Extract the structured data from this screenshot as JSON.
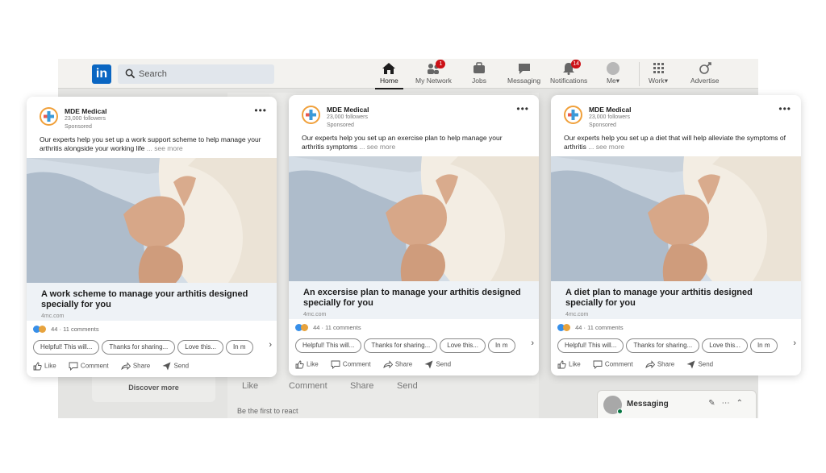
{
  "background": {
    "nav": {
      "logo": "in",
      "search_placeholder": "Search",
      "items": [
        {
          "label": "Home",
          "badge": ""
        },
        {
          "label": "My Network",
          "badge": "1"
        },
        {
          "label": "Jobs",
          "badge": ""
        },
        {
          "label": "Messaging",
          "badge": ""
        },
        {
          "label": "Notifications",
          "badge": "14"
        },
        {
          "label": "Me",
          "badge": ""
        },
        {
          "label": "Work",
          "badge": ""
        },
        {
          "label": "Advertise",
          "badge": ""
        }
      ]
    },
    "left_card_button": "Discover more",
    "post_actions": [
      "Like",
      "Comment",
      "Share",
      "Send"
    ],
    "first_to_react": "Be the first to react",
    "messaging_label": "Messaging"
  },
  "ads": [
    {
      "company": "MDE Medical",
      "followers": "23,000 followers",
      "sponsored": "Sponsored",
      "copy": "Our experts help you set up a work support scheme to help manage your arthritis alongside your working life",
      "see_more": "... see more",
      "headline": "A work scheme to manage your arthitis designed specially for you",
      "domain": "4mc.com",
      "social": "44 · 11 comments",
      "chips": [
        "Helpful! This will...",
        "Thanks for sharing...",
        "Love this...",
        "In m"
      ],
      "actions": [
        "Like",
        "Comment",
        "Share",
        "Send"
      ]
    },
    {
      "company": "MDE Medical",
      "followers": "23,000 followers",
      "sponsored": "Sponsored",
      "copy": "Our experts help you set up an exercise plan to help manage your arthritis symptoms",
      "see_more": "... see more",
      "headline": "An excersise plan to manage your arthitis designed specially for you",
      "domain": "4mc.com",
      "social": "44 · 11 comments",
      "chips": [
        "Helpful! This will...",
        "Thanks for sharing...",
        "Love this...",
        "In m"
      ],
      "actions": [
        "Like",
        "Comment",
        "Share",
        "Send"
      ]
    },
    {
      "company": "MDE Medical",
      "followers": "23,000 followers",
      "sponsored": "Sponsored",
      "copy": "Our experts help you set up a diet that will help alleviate the symptoms of arthritis",
      "see_more": "... see more",
      "headline": "A diet plan to manage your arthitis designed specially for you",
      "domain": "4mc.com",
      "social": "44 · 11 comments",
      "chips": [
        "Helpful! This will...",
        "Thanks for sharing...",
        "Love this...",
        "In m"
      ],
      "actions": [
        "Like",
        "Comment",
        "Share",
        "Send"
      ]
    }
  ],
  "colors": {
    "linkedin_blue": "#0a66c2",
    "badge_red": "#cc1016",
    "like_blue": "#378fe9",
    "logo_orange": "#f0a03a",
    "logo_cross": "#3a9ad9"
  }
}
